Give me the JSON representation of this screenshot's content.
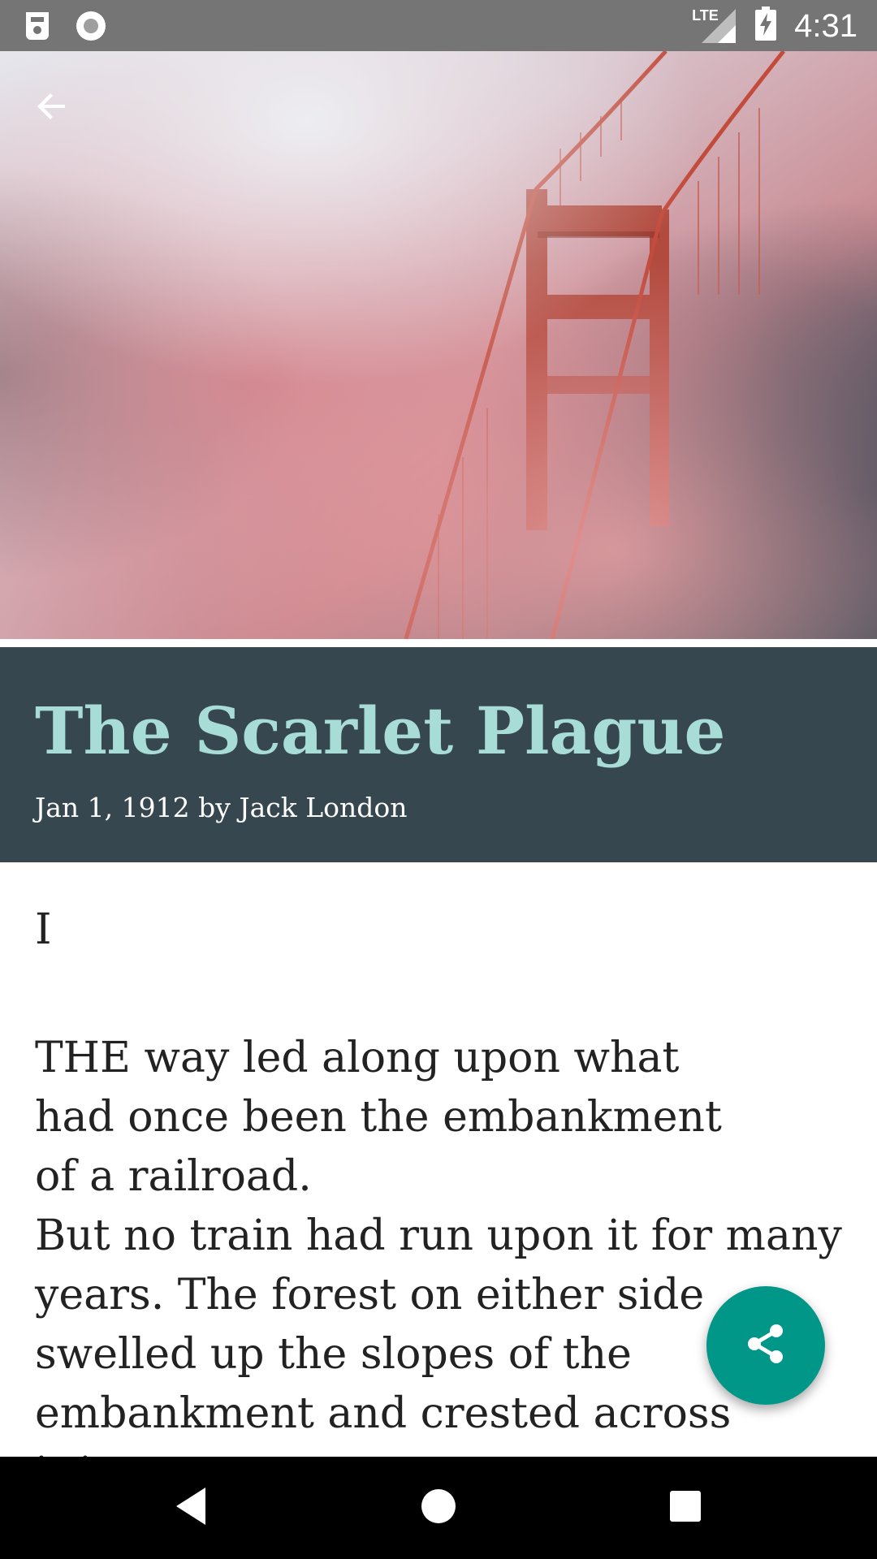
{
  "status_bar": {
    "time": "4:31",
    "network": "LTE",
    "icons": [
      "sim-card-icon",
      "record-icon",
      "signal-icon",
      "battery-charging-icon"
    ]
  },
  "hero": {
    "image": "golden-gate-bridge-in-fog",
    "back_icon": "arrow-back-icon"
  },
  "article": {
    "title": "The Scarlet Plague",
    "byline": "Jan 1, 1912 by Jack London",
    "chapter": "I",
    "lines": [
      "THE way led along upon what",
      "had once been the embankment",
      "of a railroad.",
      "But no train had run upon it for many",
      "years. The forest on either side",
      "swelled up the slopes of the",
      "embankment and crested across",
      "it in"
    ]
  },
  "fab": {
    "icon": "share-icon"
  },
  "nav_bar": {
    "buttons": [
      "back",
      "home",
      "recents"
    ]
  },
  "colors": {
    "status_bar": "#757575",
    "title_panel": "#37474f",
    "title_text": "#a8dcd7",
    "fab": "#009688"
  }
}
